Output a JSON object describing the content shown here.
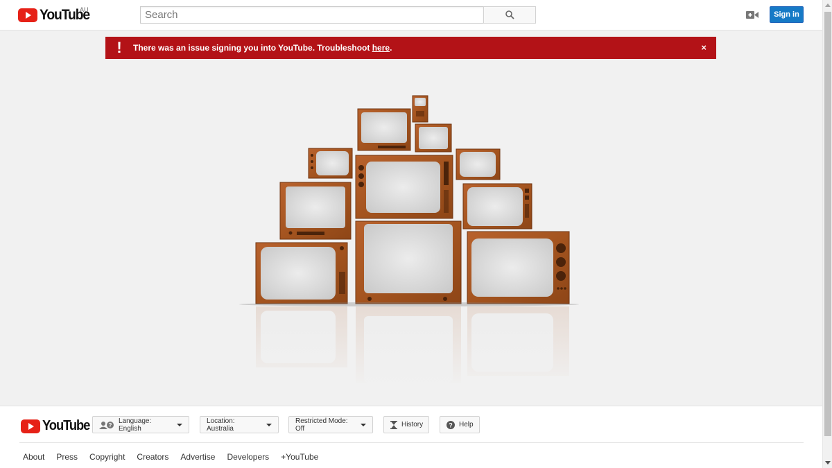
{
  "header": {
    "logo_text": "YouTube",
    "country_code": "AU",
    "search_placeholder": "Search",
    "signin_label": "Sign in"
  },
  "alert": {
    "icon": "!",
    "message": "There was an issue signing you into YouTube. Troubleshoot ",
    "link_text": "here",
    "after_link": ".",
    "close": "×",
    "color": "#b31217"
  },
  "footer": {
    "logo_text": "YouTube",
    "language_label": "Language: English",
    "location_label": "Location: Australia",
    "restricted_label": "Restricted Mode: Off",
    "history_label": "History",
    "help_label": "Help",
    "links": [
      "About",
      "Press",
      "Copyright",
      "Creators",
      "Advertise",
      "Developers",
      "+YouTube"
    ]
  },
  "colors": {
    "brand_red": "#e62117",
    "signin_blue": "#167ac6"
  }
}
